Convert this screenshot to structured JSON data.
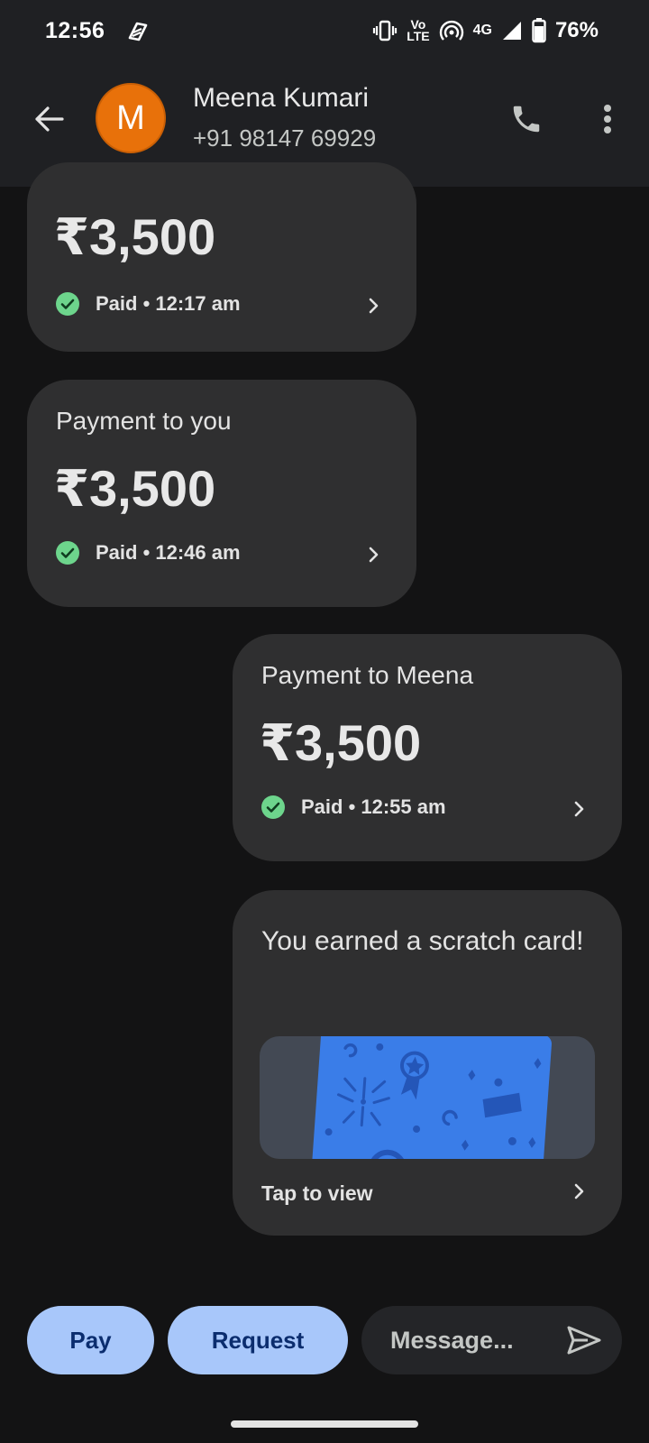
{
  "status_bar": {
    "time": "12:56",
    "volte_label_top": "Vo",
    "volte_label_bottom": "LTE",
    "network": "4G",
    "battery": "76%"
  },
  "header": {
    "avatar_letter": "M",
    "avatar_color": "#e8710a",
    "name": "Meena Kumari",
    "phone": "+91 98147 69929"
  },
  "messages": [
    {
      "amount": "₹3,500",
      "status": "Paid • 12:17 am"
    },
    {
      "title": "Payment to you",
      "amount": "₹3,500",
      "status": "Paid • 12:46 am"
    },
    {
      "title": "Payment to Meena",
      "amount": "₹3,500",
      "status": "Paid • 12:55 am"
    }
  ],
  "scratch_card": {
    "title": "You earned a scratch card!",
    "link": "Tap to view",
    "card_color": "#3a7de8"
  },
  "composer": {
    "pay_label": "Pay",
    "request_label": "Request",
    "message_placeholder": "Message..."
  },
  "colors": {
    "accent_button": "#a8c7fa",
    "paid_check": "#6dd58c",
    "card_bg": "#2f2f30"
  }
}
